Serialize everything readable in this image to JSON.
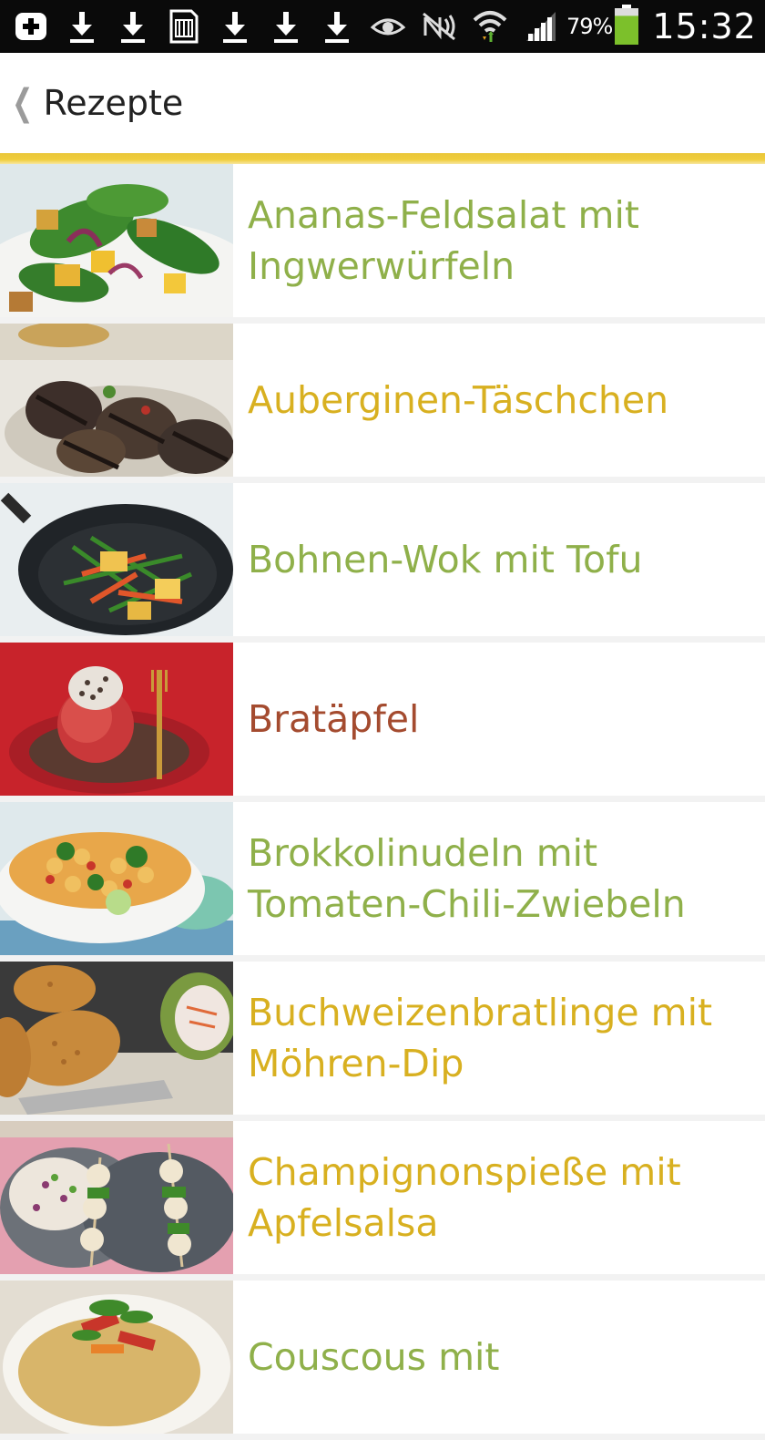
{
  "statusbar": {
    "left_icons": [
      "plus-badge-icon",
      "download-icon",
      "download-icon",
      "sd-card-icon",
      "download-icon",
      "download-icon",
      "download-icon"
    ],
    "right_icons": [
      "eye-icon",
      "nfc-muted-icon",
      "wifi-icon",
      "signal-icon"
    ],
    "battery_percent": "79%",
    "battery_level": 0.79,
    "time": "15:32"
  },
  "actionbar": {
    "title": "Rezepte",
    "back_icon": "chevron-left-icon"
  },
  "colors": {
    "accent_line": "#efcb3c",
    "green": "#8fb04a",
    "yellow": "#d8b020",
    "red": "#a44b2f"
  },
  "recipes": [
    {
      "title": "Ananas-Feldsalat mit Ingwerwürfeln",
      "color": "#8fb04a",
      "image": "salad-photo"
    },
    {
      "title": "Auberginen-Täschchen",
      "color": "#d8b020",
      "image": "grilled-eggplant-photo"
    },
    {
      "title": "Bohnen-Wok mit Tofu",
      "color": "#8fb04a",
      "image": "wok-photo"
    },
    {
      "title": "Bratäpfel",
      "color": "#a44b2f",
      "image": "baked-apple-photo"
    },
    {
      "title": "Brokkolinudeln mit Tomaten-Chili-Zwiebeln",
      "color": "#8fb04a",
      "image": "pasta-bowl-photo"
    },
    {
      "title": "Buchweizenbratlinge mit Möhren-Dip",
      "color": "#d8b020",
      "image": "patties-photo"
    },
    {
      "title": "Champignonspieße mit Apfelsalsa",
      "color": "#d8b020",
      "image": "skewers-photo"
    },
    {
      "title": "Couscous mit",
      "color": "#8fb04a",
      "image": "couscous-photo"
    }
  ]
}
